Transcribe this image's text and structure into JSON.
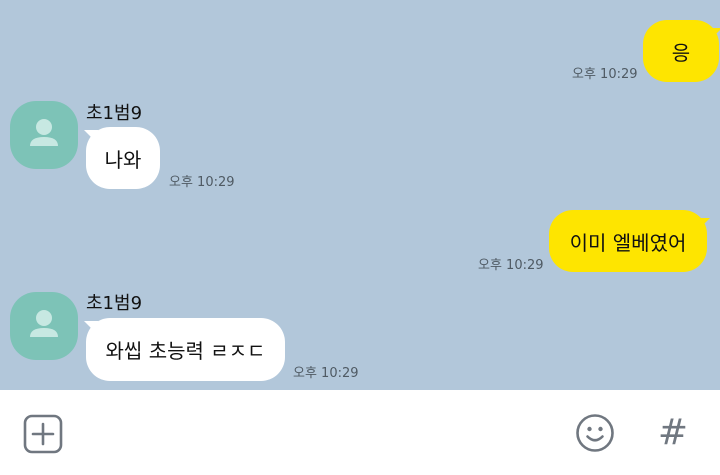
{
  "messages": [
    {
      "direction": "outgoing",
      "text": "응",
      "time": "오후 10:29"
    },
    {
      "direction": "incoming",
      "sender": "초1범9",
      "text": "나와",
      "time": "오후 10:29"
    },
    {
      "direction": "outgoing",
      "text": "이미 엘베였어",
      "time": "오후 10:29"
    },
    {
      "direction": "incoming",
      "sender": "초1범9",
      "text": "와씹 초능력 ㄹㅈㄷ",
      "time": "오후 10:29"
    }
  ],
  "input_bar": {
    "attach_icon": "plus-square-icon",
    "emoji_icon": "smiley-icon",
    "hashtag_icon": "hashtag-icon",
    "hashtag_glyph": "#"
  },
  "colors": {
    "chat_background": "#b2c7da",
    "outgoing_bubble": "#fee500",
    "incoming_bubble": "#ffffff",
    "avatar": "#7dc3b7",
    "icon": "#707780"
  }
}
